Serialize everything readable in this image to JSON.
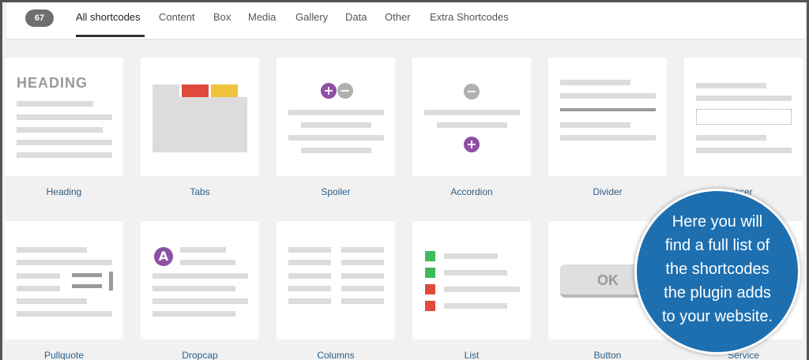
{
  "header": {
    "count": "67",
    "tabs": [
      {
        "label": "All shortcodes"
      },
      {
        "label": "Content"
      },
      {
        "label": "Box"
      },
      {
        "label": "Media"
      },
      {
        "label": "Gallery"
      },
      {
        "label": "Data"
      },
      {
        "label": "Other"
      },
      {
        "label": "Extra Shortcodes"
      }
    ]
  },
  "cards": [
    {
      "label": "Heading",
      "preview_text": "HEADING"
    },
    {
      "label": "Tabs"
    },
    {
      "label": "Spoiler"
    },
    {
      "label": "Accordion"
    },
    {
      "label": "Divider"
    },
    {
      "label": "Spacer",
      "visible_label": "acer"
    },
    {
      "label": "Pullquote"
    },
    {
      "label": "Dropcap",
      "preview_text": "A"
    },
    {
      "label": "Columns"
    },
    {
      "label": "List"
    },
    {
      "label": "Button",
      "preview_text": "OK"
    },
    {
      "label": "Service",
      "visible_label": "Service"
    }
  ],
  "callout": {
    "lines": [
      "Here you will",
      "find a full list of",
      "the shortcodes",
      "the plugin adds",
      "to your website."
    ]
  },
  "colors": {
    "accent_purple": "#8e4fa6",
    "red": "#e04a3c",
    "yellow": "#f0c33c",
    "green": "#3dbb5b",
    "callout_blue": "#1d6fb0"
  }
}
